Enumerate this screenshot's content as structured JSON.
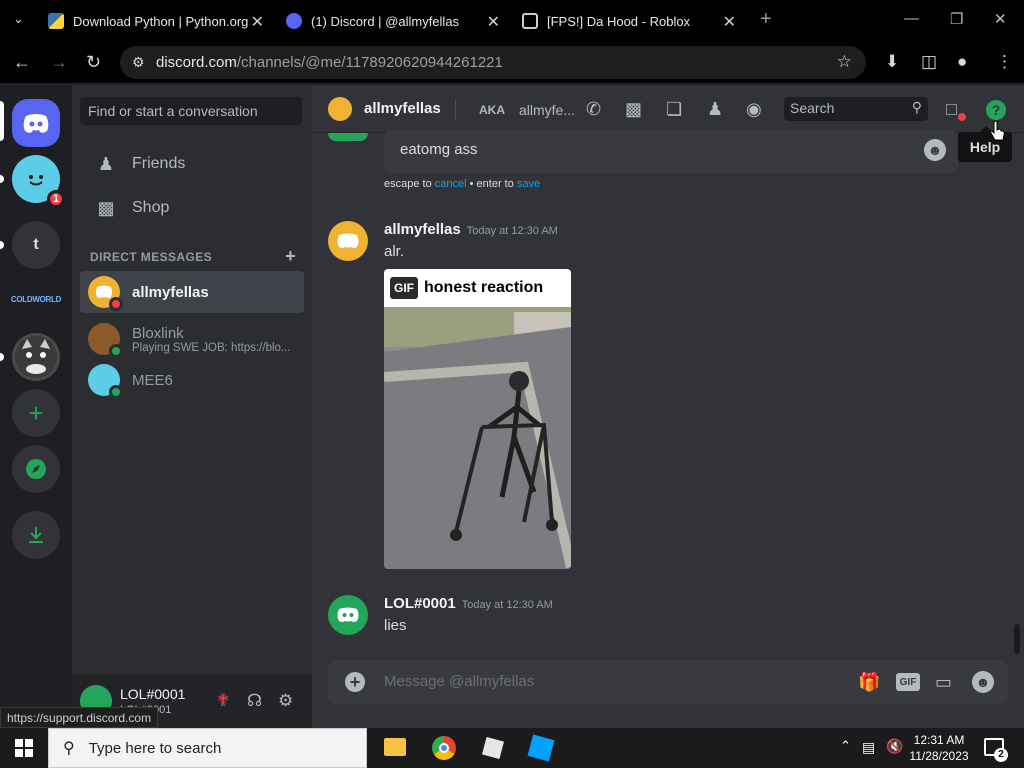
{
  "browser": {
    "tabs": [
      {
        "title": "Download Python | Python.org",
        "active": false
      },
      {
        "title": "(1) Discord | @allmyfellas",
        "active": true
      },
      {
        "title": "[FPS!] Da Hood - Roblox",
        "active": false
      }
    ],
    "url_site": "discord.com",
    "url_path": "/channels/@me/1178920620944261221",
    "status_url": "https://support.discord.com"
  },
  "guilds": {
    "items": [
      {
        "name": "home",
        "icon": "discord-logo-icon"
      },
      {
        "name": "mee6-server",
        "icon": "mee6-icon",
        "badge": "1"
      },
      {
        "name": "t-server",
        "label": "t"
      },
      {
        "name": "coldworld-server",
        "label": "COLDWORLD"
      },
      {
        "name": "cat-server",
        "icon": "cat-avatar-icon"
      },
      {
        "name": "add-server",
        "icon": "plus-icon"
      },
      {
        "name": "explore",
        "icon": "compass-icon"
      },
      {
        "name": "download-apps",
        "icon": "download-icon"
      }
    ]
  },
  "sidebar": {
    "search_placeholder": "Find or start a conversation",
    "nav": [
      {
        "label": "Friends",
        "icon": "friends-icon"
      },
      {
        "label": "Shop",
        "icon": "shop-icon"
      }
    ],
    "dm_header": "DIRECT MESSAGES",
    "dms": [
      {
        "name": "allmyfellas",
        "sub": "",
        "status": "dnd",
        "active": true
      },
      {
        "name": "Bloxlink",
        "sub": "Playing SWE JOB: https://blo...",
        "status": "online",
        "active": false
      },
      {
        "name": "MEE6",
        "sub": "",
        "status": "online",
        "active": false
      }
    ],
    "user": {
      "name": "LOL#0001",
      "tag": "LOL#0001"
    }
  },
  "header": {
    "name": "allmyfellas",
    "aka_label": "AKA",
    "aka_value": "allmyfe...",
    "search_placeholder": "Search",
    "tooltip": "Help"
  },
  "messages": {
    "editing_text": "eatomg ass",
    "hint_prefix": "escape to",
    "hint_cancel": "cancel",
    "hint_mid": "• enter to",
    "hint_save": "save",
    "list": [
      {
        "author": "allmyfellas",
        "time": "Today at 12:30 AM",
        "text": "alr."
      },
      {
        "author": "LOL#0001",
        "time": "Today at 12:30 AM",
        "text": "lies"
      }
    ],
    "gif": {
      "tag": "GIF",
      "caption": "honest reaction"
    }
  },
  "composer": {
    "placeholder": "Message @allmyfellas"
  },
  "taskbar": {
    "search_placeholder": "Type here to search",
    "time": "12:31 AM",
    "date": "11/28/2023",
    "notifications": "2"
  },
  "colors": {
    "online": "#23a55a",
    "dnd": "#f23f43",
    "blurple": "#5865f2",
    "link": "#00a8fc"
  }
}
